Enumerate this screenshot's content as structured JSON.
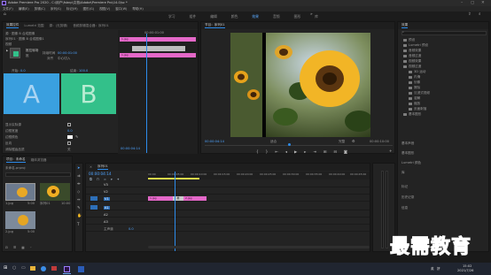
{
  "titlebar": {
    "title": "Adobe Premiere Pro 2020 - C:\\用户\\fsbnp\\文档\\Adobe\\Premiere Pro\\14.0\\sc *",
    "menus": [
      "文件(F)",
      "编辑(E)",
      "剪辑(C)",
      "序列(S)",
      "标记(M)",
      "图形(G)",
      "视图(V)",
      "窗口(W)",
      "帮助(H)"
    ]
  },
  "workspaces": [
    "学习",
    "组件",
    "编辑",
    "颜色",
    "效果",
    "音频",
    "图形",
    "库"
  ],
  "effect_controls": {
    "tabs": [
      "效果控件",
      "Lumetri 范围",
      "源：(无剪辑)",
      "音频剪辑混合器：序列01"
    ],
    "clip_name": "源 · 图像 B 合成图像",
    "sequence": "序列01 · 图像 B 合成图像1",
    "section": "视频",
    "effect": "推拉转场",
    "effect_sub": "推",
    "duration_label": "持续时间",
    "duration_value": "00:00:01:00",
    "alignment_label": "对齐",
    "alignment_value": "中心切入",
    "start_label": "开始：",
    "start_value": "0.0",
    "end_label": "结束：",
    "end_value": "100.0",
    "preview_a": "A",
    "preview_b": "B",
    "props": [
      "显示实际源",
      "边框宽度",
      "边框颜色",
      "反向",
      "消除锯齿品质"
    ],
    "border_value": "0.0",
    "aa_value": "关",
    "mini_clips": [
      "1.jpg",
      "1.jpg"
    ],
    "mini_time": "00:00:01:00",
    "mini_bottom_time": "00:00:04:14"
  },
  "program_monitor": {
    "tab": "节目：序列01",
    "timecode": "00:00:04:14",
    "fit": "适合",
    "quality": "完整",
    "duration": "00:00:10:00",
    "controls": [
      "mark-in",
      "mark-out",
      "go-to-in",
      "step-back",
      "play",
      "step-forward",
      "go-to-out",
      "insert",
      "overwrite",
      "export-frame",
      "settings"
    ]
  },
  "project": {
    "tabs": [
      "项目：未命名",
      "媒体浏览器"
    ],
    "path": "未命名.prproj",
    "items": [
      {
        "name": "1.jpg",
        "duration": "5:00"
      },
      {
        "name": "序列01",
        "duration": "10:00"
      },
      {
        "name": "2.jpg",
        "duration": "5:00"
      }
    ]
  },
  "effects_panel": {
    "tab": "效果",
    "tree": [
      "预设",
      "Lumetri 预设",
      "音频效果",
      "音频过渡",
      "视频效果",
      "视频过渡",
      "3D 运动",
      "内滑",
      "划像",
      "擦除",
      "沉浸式视频",
      "溶解",
      "缩放",
      "页面剥落",
      "基本图形"
    ],
    "sections": [
      "基本声音",
      "基本图形",
      "Lumetri 颜色",
      "库",
      "标记",
      "历史记录",
      "信息"
    ]
  },
  "timeline": {
    "tab": "序列01",
    "timecode": "00:00:04:14",
    "ruler": [
      "00:00",
      "00:00:05:00",
      "00:00:10:00",
      "00:00:15:00",
      "00:00:20:00",
      "00:00:25:00",
      "00:00:30:00",
      "00:00:35:00",
      "00:00:40:00",
      "00:00:45:00"
    ],
    "tracks": [
      "V3",
      "V2",
      "V1",
      "A1",
      "A2",
      "A3"
    ],
    "master": "主声道",
    "master_value": "0.0",
    "clip_a": "1.jpg",
    "clip_b": "2.jpg",
    "transition": "推"
  },
  "taskbar": {
    "time": "15:02",
    "date": "2021/7/26",
    "tray": [
      "英",
      "拼"
    ]
  },
  "watermark": "最需教育",
  "colors": {
    "accent": "#2d8ceb",
    "clip": "#e468c8",
    "preview_a": "#3aa0e0",
    "preview_b": "#33c08a"
  }
}
